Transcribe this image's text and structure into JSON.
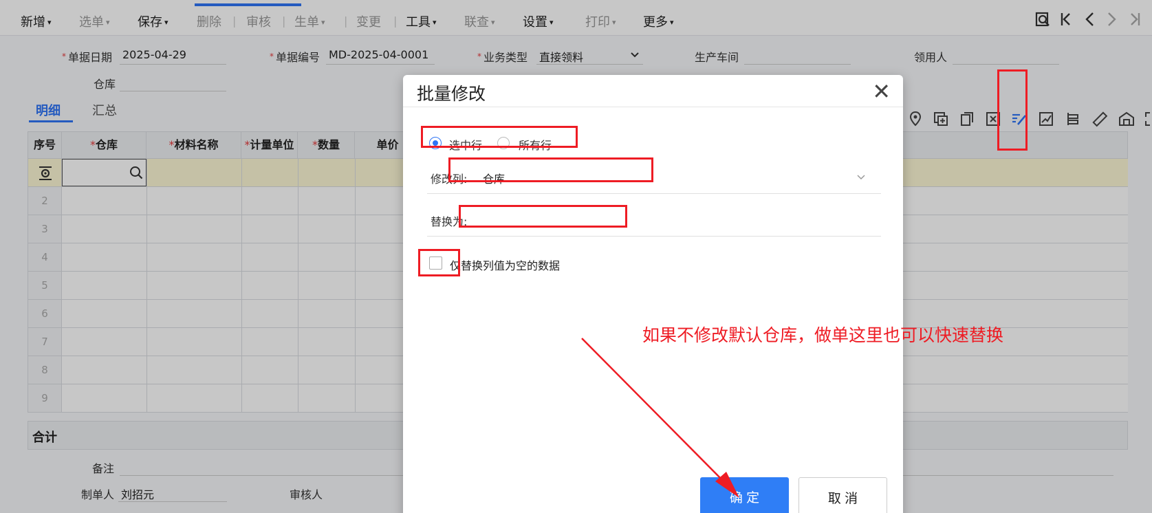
{
  "toolbar": {
    "items": [
      {
        "label": "新增",
        "caret": true,
        "dim": false
      },
      {
        "label": "选单",
        "caret": true,
        "dim": true
      },
      {
        "label": "保存",
        "caret": true,
        "dim": false
      },
      {
        "label": "删除",
        "caret": false,
        "dim": true
      },
      {
        "label": "审核",
        "caret": false,
        "dim": true
      },
      {
        "label": "生单",
        "caret": true,
        "dim": true
      },
      {
        "label": "变更",
        "caret": false,
        "dim": true
      },
      {
        "label": "工具",
        "caret": true,
        "dim": false
      },
      {
        "label": "联查",
        "caret": true,
        "dim": true
      },
      {
        "label": "设置",
        "caret": true,
        "dim": false
      },
      {
        "label": "打印",
        "caret": true,
        "dim": true
      },
      {
        "label": "更多",
        "caret": true,
        "dim": false
      }
    ],
    "nav_icons": [
      "search-document-icon",
      "first-page-icon",
      "prev-page-icon",
      "next-page-icon",
      "last-page-icon"
    ]
  },
  "form": {
    "date_label": "单据日期",
    "date_value": "2025-04-29",
    "number_label": "单据编号",
    "number_value": "MD-2025-04-0001",
    "biz_type_label": "业务类型",
    "biz_type_value": "直接领料",
    "workshop_label": "生产车间",
    "workshop_value": "",
    "receiver_label": "领用人",
    "receiver_value": "",
    "warehouse_label": "仓库",
    "warehouse_value": "",
    "remark_label": "备注",
    "maker_label": "制单人",
    "maker_value": "刘招元",
    "auditor_label": "审核人"
  },
  "tabs": [
    {
      "label": "明细",
      "active": true
    },
    {
      "label": "汇总",
      "active": false
    }
  ],
  "grid": {
    "columns": [
      {
        "label": "序号",
        "required": false
      },
      {
        "label": "仓库",
        "required": true
      },
      {
        "label": "材料名称",
        "required": true
      },
      {
        "label": "计量单位",
        "required": true
      },
      {
        "label": "数量",
        "required": true
      },
      {
        "label": "单价",
        "required": false
      }
    ],
    "row_numbers": [
      "2",
      "3",
      "4",
      "5",
      "6",
      "7",
      "8",
      "9"
    ],
    "total_label": "合计"
  },
  "dialog": {
    "title": "批量修改",
    "radio_selected": "选中行",
    "radio_all": "所有行",
    "column_label": "修改列:",
    "column_value": "仓库",
    "replace_label": "替换为:",
    "replace_value": "",
    "only_empty_label": "仅替换列值为空的数据",
    "ok_label": "确 定",
    "cancel_label": "取 消"
  },
  "annotation": {
    "text": "如果不修改默认仓库，做单这里也可以快速替换",
    "color": "#ee1c24"
  },
  "colors": {
    "accent": "#2f74f5",
    "annotation": "#ee1c24"
  }
}
